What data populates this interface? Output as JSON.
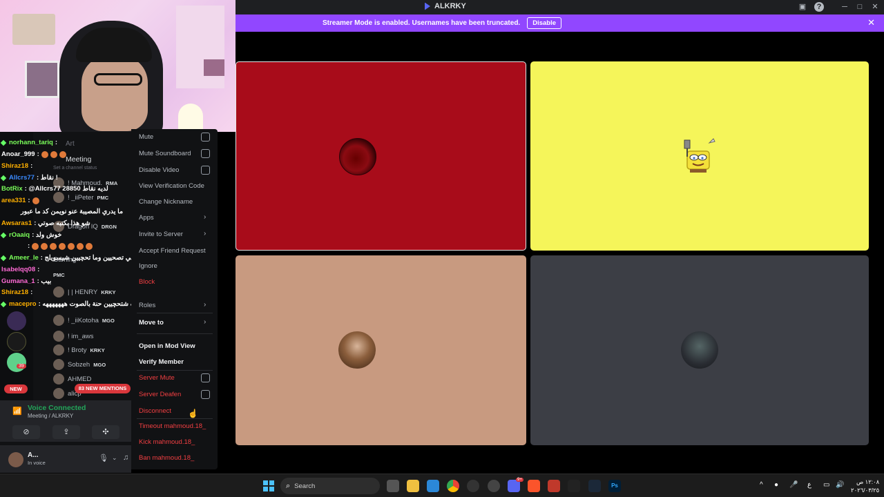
{
  "window": {
    "title": "ALKRKY"
  },
  "banner": {
    "text": "Streamer Mode is enabled. Usernames have been truncated.",
    "button": "Disable"
  },
  "channel": {
    "name": "Meeting",
    "status_placeholder": "Set a channel status",
    "category": "Art"
  },
  "chat": [
    {
      "user": "norhann_tariq",
      "color": "#7bff5a",
      "msg": ":"
    },
    {
      "user": "Anoar_999",
      "color": "#ffffff",
      "msg": ":"
    },
    {
      "user": "Shiraz18",
      "color": "#ffb000",
      "msg": ":"
    },
    {
      "user": "Allcrs77",
      "color": "#3b8bff",
      "msg": ": نقاط !"
    },
    {
      "user": "BotRix",
      "color": "#7bff5a",
      "msg": ": @Allcrs77 28850 لديه نقاط"
    },
    {
      "user": "area331",
      "color": "#ffb000",
      "msg": ":"
    },
    {
      "user": "",
      "color": "#ffffff",
      "msg": "ما يدري المصيبة عنو نويمن كد ما عبور"
    },
    {
      "user": "Awsaras1",
      "color": "#ffb000",
      "msg": ": شو هذا بكتبه صوتي"
    },
    {
      "user": "rOaaiq",
      "color": "#7bff5a",
      "msg": ": خوش ولد"
    },
    {
      "user": "",
      "color": "#ff5050",
      "msg": ":"
    },
    {
      "user": "Ameer_le",
      "color": "#7bff5a",
      "msg": ": يعني تصحيين وما تحچيين شيسويلج"
    },
    {
      "user": "Isabelqq08",
      "color": "#ff6ad5",
      "msg": ":"
    },
    {
      "user": "Gumana_1",
      "color": "#ff6ad5",
      "msg": ": بيب"
    },
    {
      "user": "Shiraz18",
      "color": "#ffb000",
      "msg": ":"
    },
    {
      "user": "macepro",
      "color": "#ffb000",
      "msg": ": اي الي راعرف شتحچيين حنة بالصوت هههههههه"
    }
  ],
  "voice_members": [
    {
      "name": "! Mahmoud.",
      "tag": "RMA"
    },
    {
      "name": "! _iiPeter",
      "tag": "PMC"
    },
    {
      "name": "Dragon IQ",
      "tag": "DRGN"
    },
    {
      "name": "Gaming",
      "tag": ""
    },
    {
      "name": "",
      "tag": "PMC"
    },
    {
      "name": "| | HENRY",
      "tag": "KRKY"
    },
    {
      "name": "! _iiKotoha",
      "tag": "MGO"
    },
    {
      "name": "! im_aws",
      "tag": ""
    },
    {
      "name": "! Broty",
      "tag": "KRKY"
    },
    {
      "name": "Sobzeh",
      "tag": "MGO"
    },
    {
      "name": "AHMED",
      "tag": ""
    },
    {
      "name": "alicp",
      "tag": ""
    }
  ],
  "badges": {
    "mentions": "83 NEW MENTIONS",
    "new": "NEW",
    "server_count": "39"
  },
  "voice": {
    "status": "Voice Connected",
    "channel": "Meeting / ALKRKY"
  },
  "user": {
    "name": "A...",
    "status": "In voice"
  },
  "context_menu": [
    {
      "label": "Mute",
      "kind": "check"
    },
    {
      "label": "Mute Soundboard",
      "kind": "check"
    },
    {
      "label": "Disable Video",
      "kind": "check"
    },
    {
      "label": "View Verification Code",
      "kind": "plain"
    },
    {
      "label": "Change Nickname",
      "kind": "plain"
    },
    {
      "label": "Apps",
      "kind": "submenu"
    },
    {
      "label": "Invite to Server",
      "kind": "submenu"
    },
    {
      "label": "Accept Friend Request",
      "kind": "plain"
    },
    {
      "label": "Ignore",
      "kind": "plain"
    },
    {
      "label": "Block",
      "kind": "danger"
    },
    {
      "label": "Roles",
      "kind": "submenu"
    },
    {
      "label": "Move to",
      "kind": "submenu-strong"
    },
    {
      "label": "Open in Mod View",
      "kind": "strong"
    },
    {
      "label": "Verify Member",
      "kind": "strong"
    },
    {
      "label": "Server Mute",
      "kind": "danger-check"
    },
    {
      "label": "Server Deafen",
      "kind": "danger-check"
    },
    {
      "label": "Disconnect",
      "kind": "danger"
    },
    {
      "label": "Timeout mahmoud.18_",
      "kind": "danger"
    },
    {
      "label": "Kick mahmoud.18_",
      "kind": "danger"
    },
    {
      "label": "Ban mahmoud.18_",
      "kind": "danger"
    }
  ],
  "taskbar": {
    "search_label": "Search",
    "time": "١٢:٠٨ ص",
    "date": "٢٠٢٦/٠٣/٢٥",
    "discord_badge": "9+"
  },
  "colors": {
    "banner": "#9147ff",
    "tile_red": "#a80c1a",
    "tile_yellow": "#f5f55a",
    "tile_tan": "#c89a80",
    "tile_gray": "#3c3e45",
    "danger": "#f23f42",
    "voice_green": "#23a55a"
  }
}
